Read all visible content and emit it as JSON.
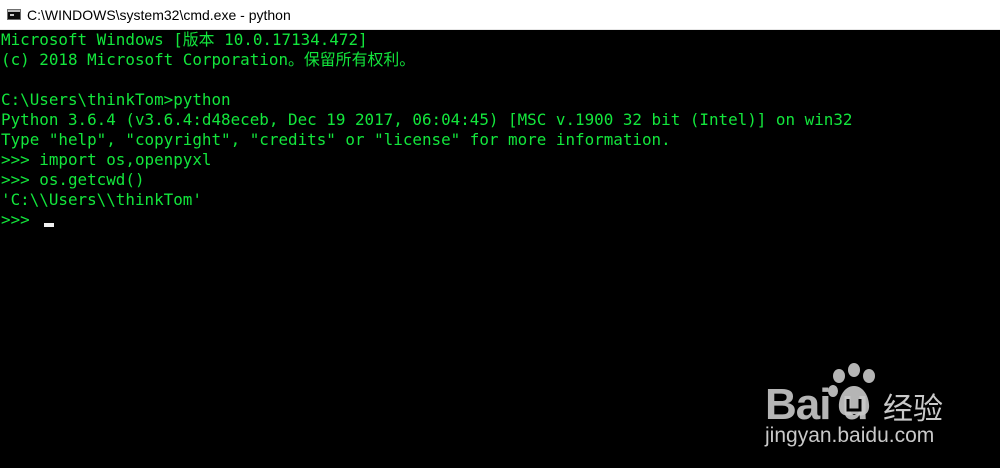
{
  "window": {
    "title": "C:\\WINDOWS\\system32\\cmd.exe - python",
    "icon": "cmd-icon"
  },
  "console": {
    "lines": [
      "Microsoft Windows [版本 10.0.17134.472]",
      "(c) 2018 Microsoft Corporation。保留所有权利。",
      "",
      "C:\\Users\\thinkTom>python",
      "Python 3.6.4 (v3.6.4:d48eceb, Dec 19 2017, 06:04:45) [MSC v.1900 32 bit (Intel)] on win32",
      "Type \"help\", \"copyright\", \"credits\" or \"license\" for more information.",
      ">>> import os,openpyxl",
      ">>> os.getcwd()",
      "'C:\\\\Users\\\\thinkTom'",
      ">>> "
    ],
    "text_color": "#13e63c",
    "background_color": "#000000"
  },
  "watermark": {
    "brand": "Bai  u",
    "brand_cn": "经验",
    "url": "jingyan.baidu.com",
    "icon": "baidu-paw-icon"
  }
}
